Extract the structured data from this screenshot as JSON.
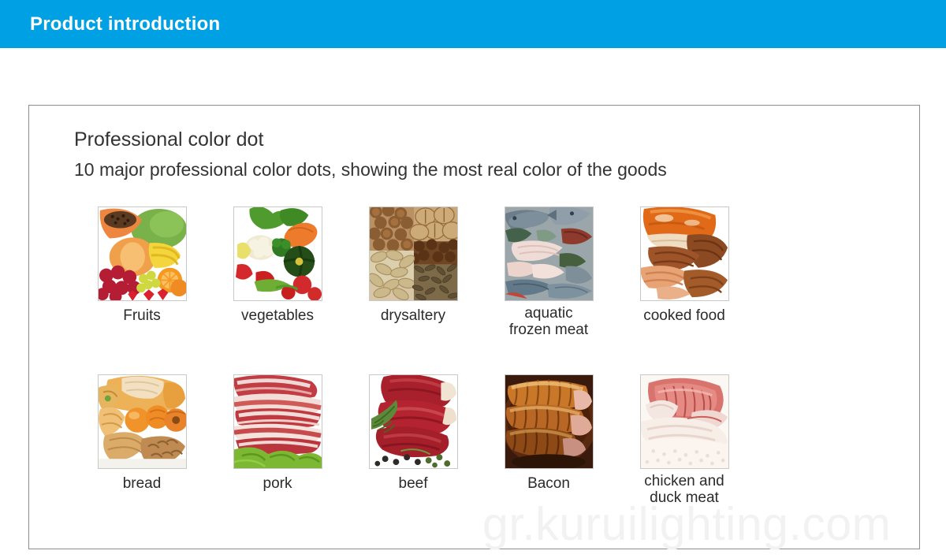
{
  "banner": {
    "title": "Product introduction",
    "bg_color": "#00a0e4",
    "text_color": "#ffffff"
  },
  "card": {
    "heading": "Professional color dot",
    "subheading": "10 major professional color dots, showing the most real color of the goods",
    "border_color": "#8d8d8d"
  },
  "products": {
    "row1": [
      {
        "label": "Fruits",
        "image": "fruits-photo"
      },
      {
        "label": "vegetables",
        "image": "vegetables-photo"
      },
      {
        "label": "drysaltery",
        "image": "drysaltery-photo"
      },
      {
        "label": "aquatic",
        "label2": "frozen meat",
        "image": "aquatic-frozen-meat-photo"
      },
      {
        "label": "cooked food",
        "image": "cooked-food-photo"
      }
    ],
    "row2": [
      {
        "label": "bread",
        "image": "bread-photo"
      },
      {
        "label": "pork",
        "image": "pork-photo"
      },
      {
        "label": "beef",
        "image": "beef-photo"
      },
      {
        "label": "Bacon",
        "image": "bacon-photo"
      },
      {
        "label": "chicken and",
        "label2": "duck meat",
        "image": "chicken-and-duck-meat-photo"
      }
    ]
  },
  "watermark": {
    "text": "gr.kuruilighting.com",
    "color": "#f2f2f2"
  }
}
